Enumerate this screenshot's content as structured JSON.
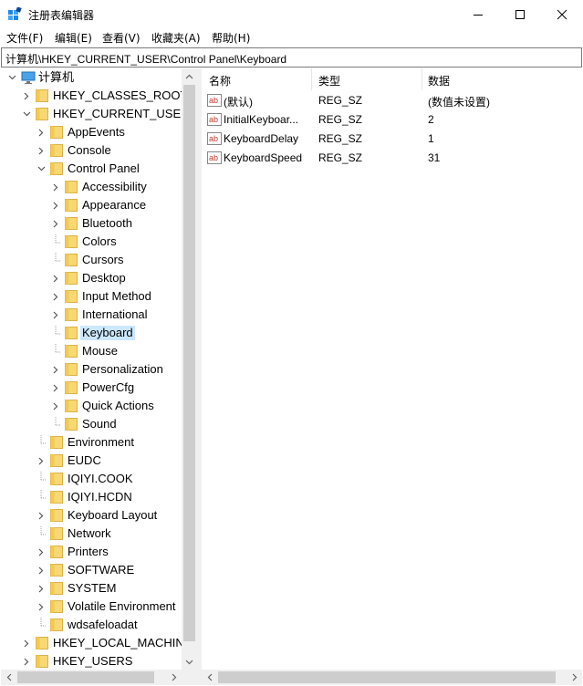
{
  "window": {
    "title": "注册表编辑器"
  },
  "menu": [
    "文件(F)",
    "编辑(E)",
    "查看(V)",
    "收藏夹(A)",
    "帮助(H)"
  ],
  "address": "计算机\\HKEY_CURRENT_USER\\Control Panel\\Keyboard",
  "tree": [
    {
      "label": "计算机",
      "expander": "expanded",
      "icon": "computer-icon"
    },
    {
      "label": "HKEY_CLASSES_ROOT",
      "expander": "collapsed"
    },
    {
      "label": "HKEY_CURRENT_USER",
      "expander": "expanded"
    },
    {
      "label": "AppEvents",
      "expander": "collapsed"
    },
    {
      "label": "Console",
      "expander": "collapsed"
    },
    {
      "label": "Control Panel",
      "expander": "expanded"
    },
    {
      "label": "Accessibility",
      "expander": "collapsed"
    },
    {
      "label": "Appearance",
      "expander": "collapsed"
    },
    {
      "label": "Bluetooth",
      "expander": "collapsed"
    },
    {
      "label": "Colors",
      "expander": "none"
    },
    {
      "label": "Cursors",
      "expander": "none"
    },
    {
      "label": "Desktop",
      "expander": "collapsed"
    },
    {
      "label": "Input Method",
      "expander": "collapsed"
    },
    {
      "label": "International",
      "expander": "collapsed"
    },
    {
      "label": "Keyboard",
      "expander": "none",
      "selected": true
    },
    {
      "label": "Mouse",
      "expander": "none"
    },
    {
      "label": "Personalization",
      "expander": "collapsed"
    },
    {
      "label": "PowerCfg",
      "expander": "collapsed"
    },
    {
      "label": "Quick Actions",
      "expander": "collapsed"
    },
    {
      "label": "Sound",
      "expander": "none"
    },
    {
      "label": "Environment",
      "expander": "none"
    },
    {
      "label": "EUDC",
      "expander": "collapsed"
    },
    {
      "label": "IQIYI.COOK",
      "expander": "none"
    },
    {
      "label": "IQIYI.HCDN",
      "expander": "none"
    },
    {
      "label": "Keyboard Layout",
      "expander": "collapsed"
    },
    {
      "label": "Network",
      "expander": "none"
    },
    {
      "label": "Printers",
      "expander": "collapsed"
    },
    {
      "label": "SOFTWARE",
      "expander": "collapsed"
    },
    {
      "label": "SYSTEM",
      "expander": "collapsed"
    },
    {
      "label": "Volatile Environment",
      "expander": "collapsed"
    },
    {
      "label": "wdsafeloadat",
      "expander": "none"
    },
    {
      "label": "HKEY_LOCAL_MACHINE",
      "expander": "collapsed"
    },
    {
      "label": "HKEY_USERS",
      "expander": "collapsed"
    }
  ],
  "columns": [
    "名称",
    "类型",
    "数据"
  ],
  "values": [
    {
      "name": "(默认)",
      "type": "REG_SZ",
      "data": "(数值未设置)"
    },
    {
      "name": "InitialKeyboar...",
      "type": "REG_SZ",
      "data": "2"
    },
    {
      "name": "KeyboardDelay",
      "type": "REG_SZ",
      "data": "1"
    },
    {
      "name": "KeyboardSpeed",
      "type": "REG_SZ",
      "data": "31"
    }
  ],
  "colors": {
    "folder": "#f8d775",
    "selection": "#cce8ff",
    "value_icon": "#c4372b"
  }
}
